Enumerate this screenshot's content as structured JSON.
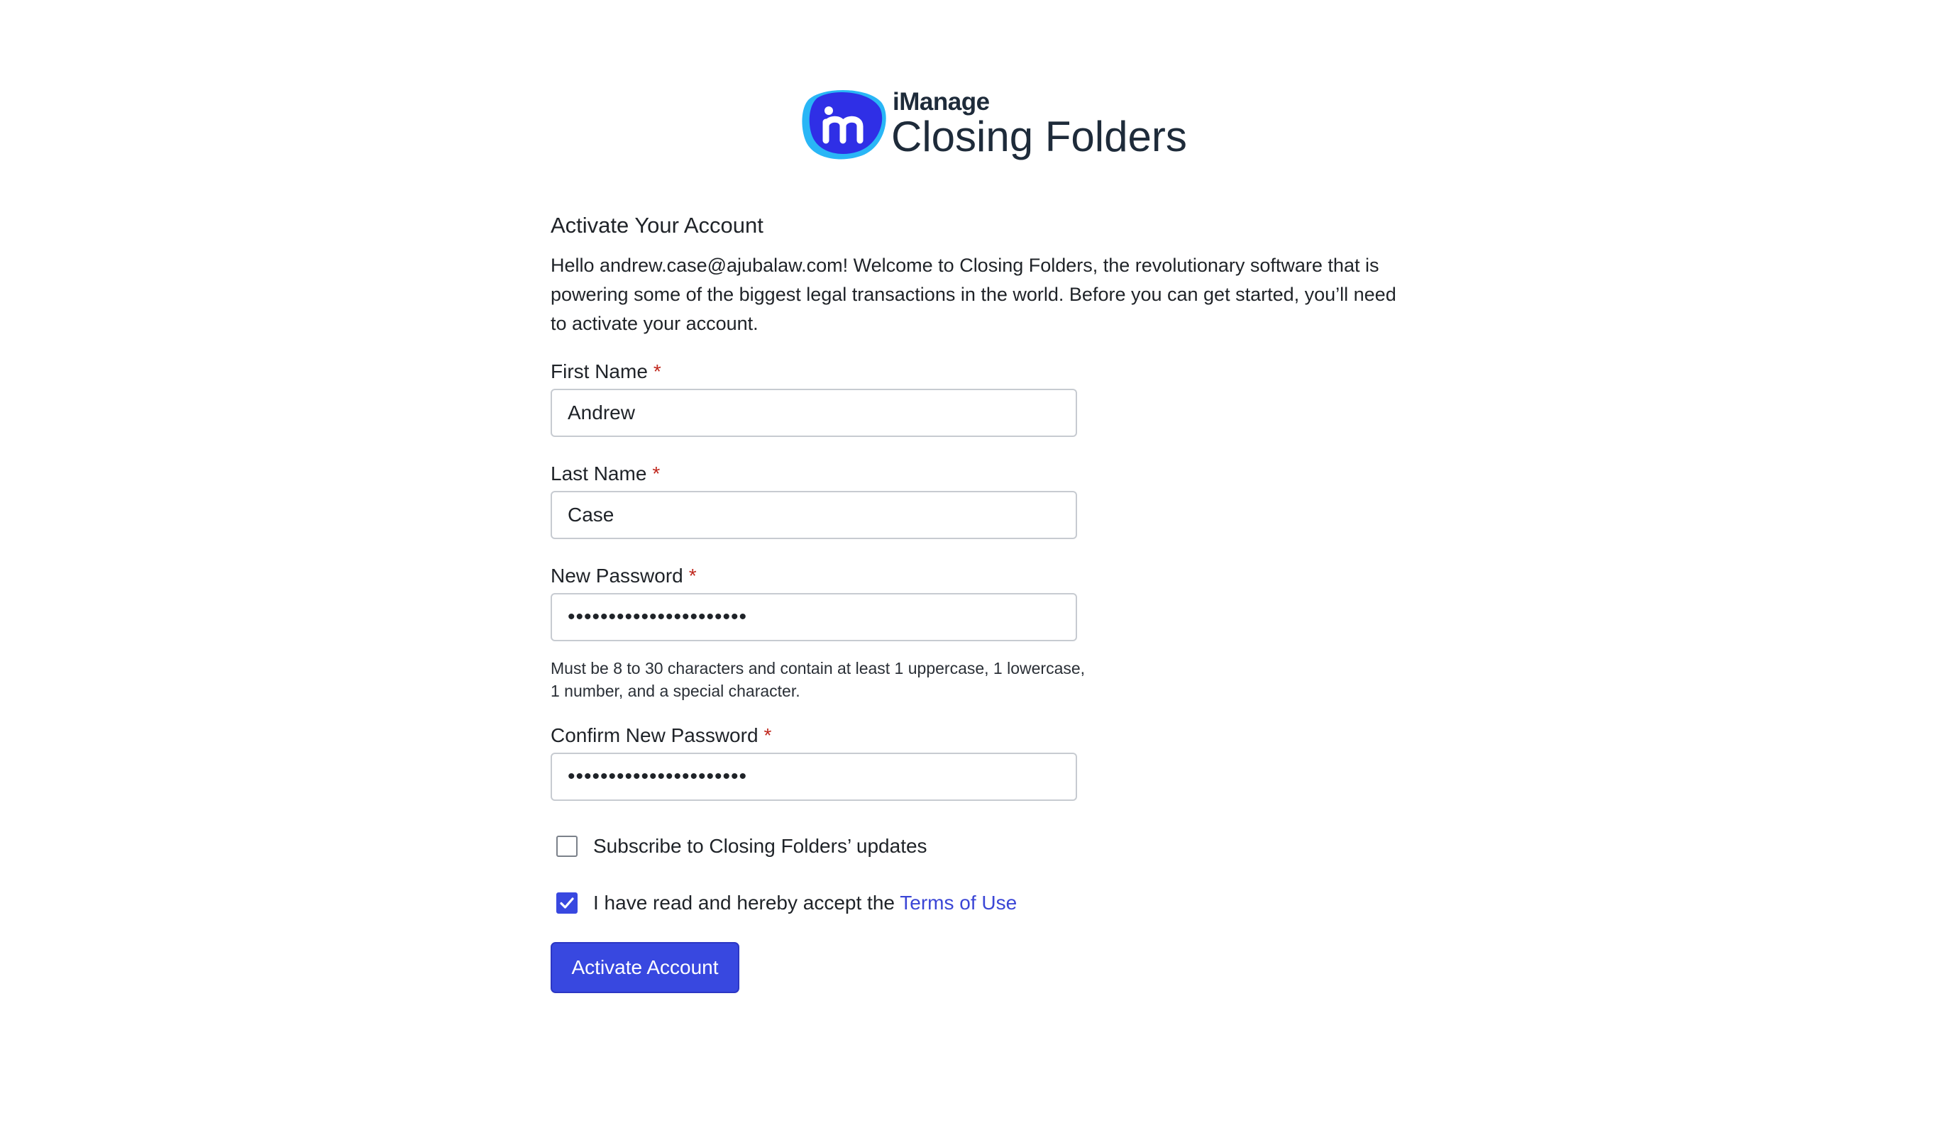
{
  "logo": {
    "brand": "iManage",
    "product": "Closing Folders",
    "icon": "imanage-logo-icon",
    "colors": {
      "outer": "#29b6f6",
      "inner": "#2f2fe6"
    }
  },
  "form": {
    "heading": "Activate Your Account",
    "intro": "Hello andrew.case@ajubalaw.com! Welcome to Closing Folders, the revolutionary software that is powering some of the biggest legal transactions in the world. Before you can get started, you’ll need to activate your account.",
    "required_marker": "*",
    "first_name": {
      "label": "First Name",
      "value": "Andrew"
    },
    "last_name": {
      "label": "Last Name",
      "value": "Case"
    },
    "new_password": {
      "label": "New Password",
      "value": "••••••••••••••••••••••",
      "hint": "Must be 8 to 30 characters and contain at least 1 uppercase, 1 lowercase, 1 number, and a special character."
    },
    "confirm_password": {
      "label": "Confirm New Password",
      "value": "••••••••••••••••••••••"
    },
    "subscribe": {
      "label": "Subscribe to Closing Folders’ updates",
      "checked": false
    },
    "terms": {
      "label_prefix": "I have read and hereby accept the",
      "link_text": "Terms of Use",
      "checked": true
    },
    "submit_label": "Activate Account"
  },
  "colors": {
    "primary": "#3848e0",
    "required": "#c0281e",
    "link": "#3b46d6"
  }
}
